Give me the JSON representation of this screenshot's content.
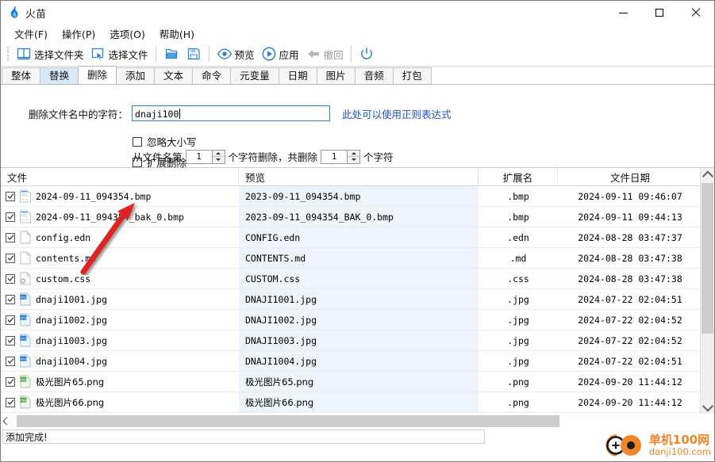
{
  "window": {
    "title": "火苗",
    "icon": "flame-icon",
    "minimize": "−",
    "maximize": "□",
    "close": "✕"
  },
  "menubar": {
    "items": [
      {
        "label": "文件(F)",
        "name": "menu-file"
      },
      {
        "label": "操作(P)",
        "name": "menu-operate"
      },
      {
        "label": "选项(O)",
        "name": "menu-options"
      },
      {
        "label": "帮助(H)",
        "name": "menu-help"
      }
    ]
  },
  "toolbar": {
    "buttons": [
      {
        "label": "选择文件夹",
        "icon": "folder-book-icon",
        "disabled": false
      },
      {
        "label": "选择文件",
        "icon": "cursor-select-icon",
        "disabled": false
      },
      {
        "label": "",
        "icon": "open-folder-icon",
        "disabled": false
      },
      {
        "label": "",
        "icon": "save-disk-icon",
        "disabled": false
      },
      {
        "label": "预览",
        "icon": "eye-icon",
        "disabled": false
      },
      {
        "label": "应用",
        "icon": "play-circle-icon",
        "disabled": false
      },
      {
        "label": "撤回",
        "icon": "undo-arrow-icon",
        "disabled": true
      },
      {
        "label": "",
        "icon": "power-icon",
        "disabled": false
      }
    ]
  },
  "tabs": {
    "items": [
      {
        "label": "整体",
        "state": "normal"
      },
      {
        "label": "替换",
        "state": "highlight"
      },
      {
        "label": "删除",
        "state": "active"
      },
      {
        "label": "添加",
        "state": "normal"
      },
      {
        "label": "文本",
        "state": "normal"
      },
      {
        "label": "命令",
        "state": "normal"
      },
      {
        "label": "元变量",
        "state": "normal"
      },
      {
        "label": "日期",
        "state": "normal"
      },
      {
        "label": "图片",
        "state": "normal"
      },
      {
        "label": "音频",
        "state": "normal"
      },
      {
        "label": "打包",
        "state": "normal"
      }
    ]
  },
  "panel": {
    "field_label": "删除文件名中的字符：",
    "field_value": "dnaji100",
    "field_placeholder": "",
    "hint_link": "此处可以使用正则表达式",
    "checkbox_ignore_case": {
      "label": "忽略大小写",
      "checked": false
    },
    "checkbox_extension_delete": {
      "label": "扩展删除",
      "checked": false
    },
    "spin_row": {
      "prefix": "从文件名第",
      "start_value": "1",
      "middle": "个字符删除，共删除",
      "count_value": "1",
      "suffix": "个字符"
    }
  },
  "list": {
    "columns": [
      {
        "label": "文件",
        "name": "col-file"
      },
      {
        "label": "预览",
        "name": "col-preview"
      },
      {
        "label": "扩展名",
        "name": "col-extension"
      },
      {
        "label": "文件日期",
        "name": "col-date"
      }
    ],
    "rows": [
      {
        "checked": true,
        "icon": "bmp-file-icon",
        "file": "2024-09-11_094354.bmp",
        "preview": "2023-09-11_094354.bmp",
        "ext": ".bmp",
        "date": "2024-09-11 09:46:07"
      },
      {
        "checked": true,
        "icon": "bmp-file-icon",
        "file": "2024-09-11_094354_bak_0.bmp",
        "preview": "2023-09-11_094354_BAK_0.bmp",
        "ext": ".bmp",
        "date": "2024-09-11 09:44:13"
      },
      {
        "checked": true,
        "icon": "generic-file-icon",
        "file": "config.edn",
        "preview": "CONFIG.edn",
        "ext": ".edn",
        "date": "2024-08-28 03:47:37"
      },
      {
        "checked": true,
        "icon": "generic-file-icon",
        "file": "contents.md",
        "preview": "CONTENTS.md",
        "ext": ".md",
        "date": "2024-08-28 03:47:38"
      },
      {
        "checked": true,
        "icon": "gear-file-icon",
        "file": "custom.css",
        "preview": "CUSTOM.css",
        "ext": ".css",
        "date": "2024-08-28 03:47:38"
      },
      {
        "checked": true,
        "icon": "jpg-file-icon",
        "file": "dnaji1001.jpg",
        "preview": "DNAJI1001.jpg",
        "ext": ".jpg",
        "date": "2024-07-22 02:04:51"
      },
      {
        "checked": true,
        "icon": "jpg-file-icon",
        "file": "dnaji1002.jpg",
        "preview": "DNAJI1002.jpg",
        "ext": ".jpg",
        "date": "2024-07-22 02:04:52"
      },
      {
        "checked": true,
        "icon": "jpg-file-icon",
        "file": "dnaji1003.jpg",
        "preview": "DNAJI1003.jpg",
        "ext": ".jpg",
        "date": "2024-07-22 02:04:52"
      },
      {
        "checked": true,
        "icon": "jpg-file-icon",
        "file": "dnaji1004.jpg",
        "preview": "DNAJI1004.jpg",
        "ext": ".jpg",
        "date": "2024-07-22 02:04:51"
      },
      {
        "checked": true,
        "icon": "png-file-icon",
        "file": "极光图片65.png",
        "preview": "极光图片65.png",
        "ext": ".png",
        "date": "2024-09-20 11:44:12"
      },
      {
        "checked": true,
        "icon": "png-file-icon",
        "file": "极光图片66.png",
        "preview": "极光图片66.png",
        "ext": ".png",
        "date": "2024-09-20 11:44:12"
      }
    ]
  },
  "status": {
    "message": "添加完成!"
  },
  "watermark": {
    "line1": "单机100网",
    "line2": "danji100.com",
    "color": "#f0862a"
  },
  "colors": {
    "accent": "#2b7fd4",
    "link": "#1a4fc4",
    "tab_highlight": "#d7e9f7",
    "preview_bg": "#eef4fb",
    "annotation_arrow": "#e02020"
  }
}
